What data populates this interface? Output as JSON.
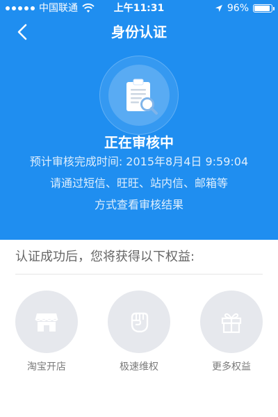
{
  "status_bar": {
    "carrier": "中国联通",
    "time": "上午11:31",
    "battery": "96%",
    "battery_level": 0.96,
    "icons": [
      "signal-dots-icon",
      "wifi-icon",
      "location-arrow-icon",
      "battery-icon"
    ]
  },
  "nav": {
    "title": "身份认证",
    "back_icon": "chevron-left-icon"
  },
  "review": {
    "icon": "clipboard-search-icon",
    "status": "正在审核中",
    "eta": "预计审核完成时间: 2015年8月4日 9:59:04",
    "notice_lines": [
      "请通过短信、旺旺、站内信、邮箱等",
      "方式查看审核结果"
    ]
  },
  "benefits": {
    "heading": "认证成功后，您将获得以下权益:",
    "items": [
      {
        "label": "淘宝开店",
        "icon": "storefront-icon"
      },
      {
        "label": "极速维权",
        "icon": "fist-icon"
      },
      {
        "label": "更多权益",
        "icon": "gift-icon"
      }
    ]
  },
  "colors": {
    "primary_blue": "#1f8ef0",
    "benefit_circle": "#e6e8ed",
    "text_gray": "#7a7a7a"
  }
}
